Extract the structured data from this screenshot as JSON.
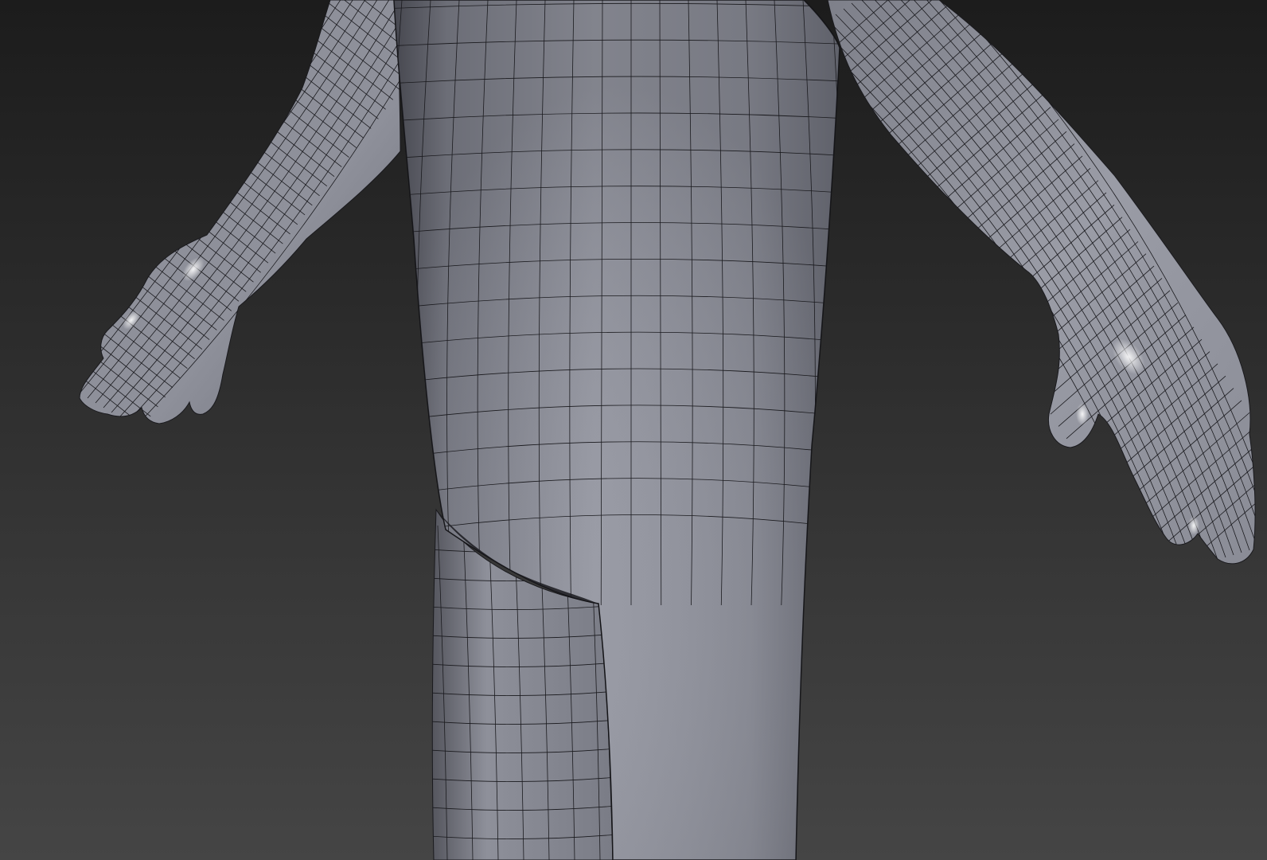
{
  "viewport": {
    "background_top": "#1c1c1c",
    "background_bottom": "#454545",
    "mesh_fill": "#8a8c96",
    "mesh_highlight": "#b4b6c0",
    "mesh_shadow": "#4a4b52",
    "wire_color": "#1a1a1e"
  }
}
